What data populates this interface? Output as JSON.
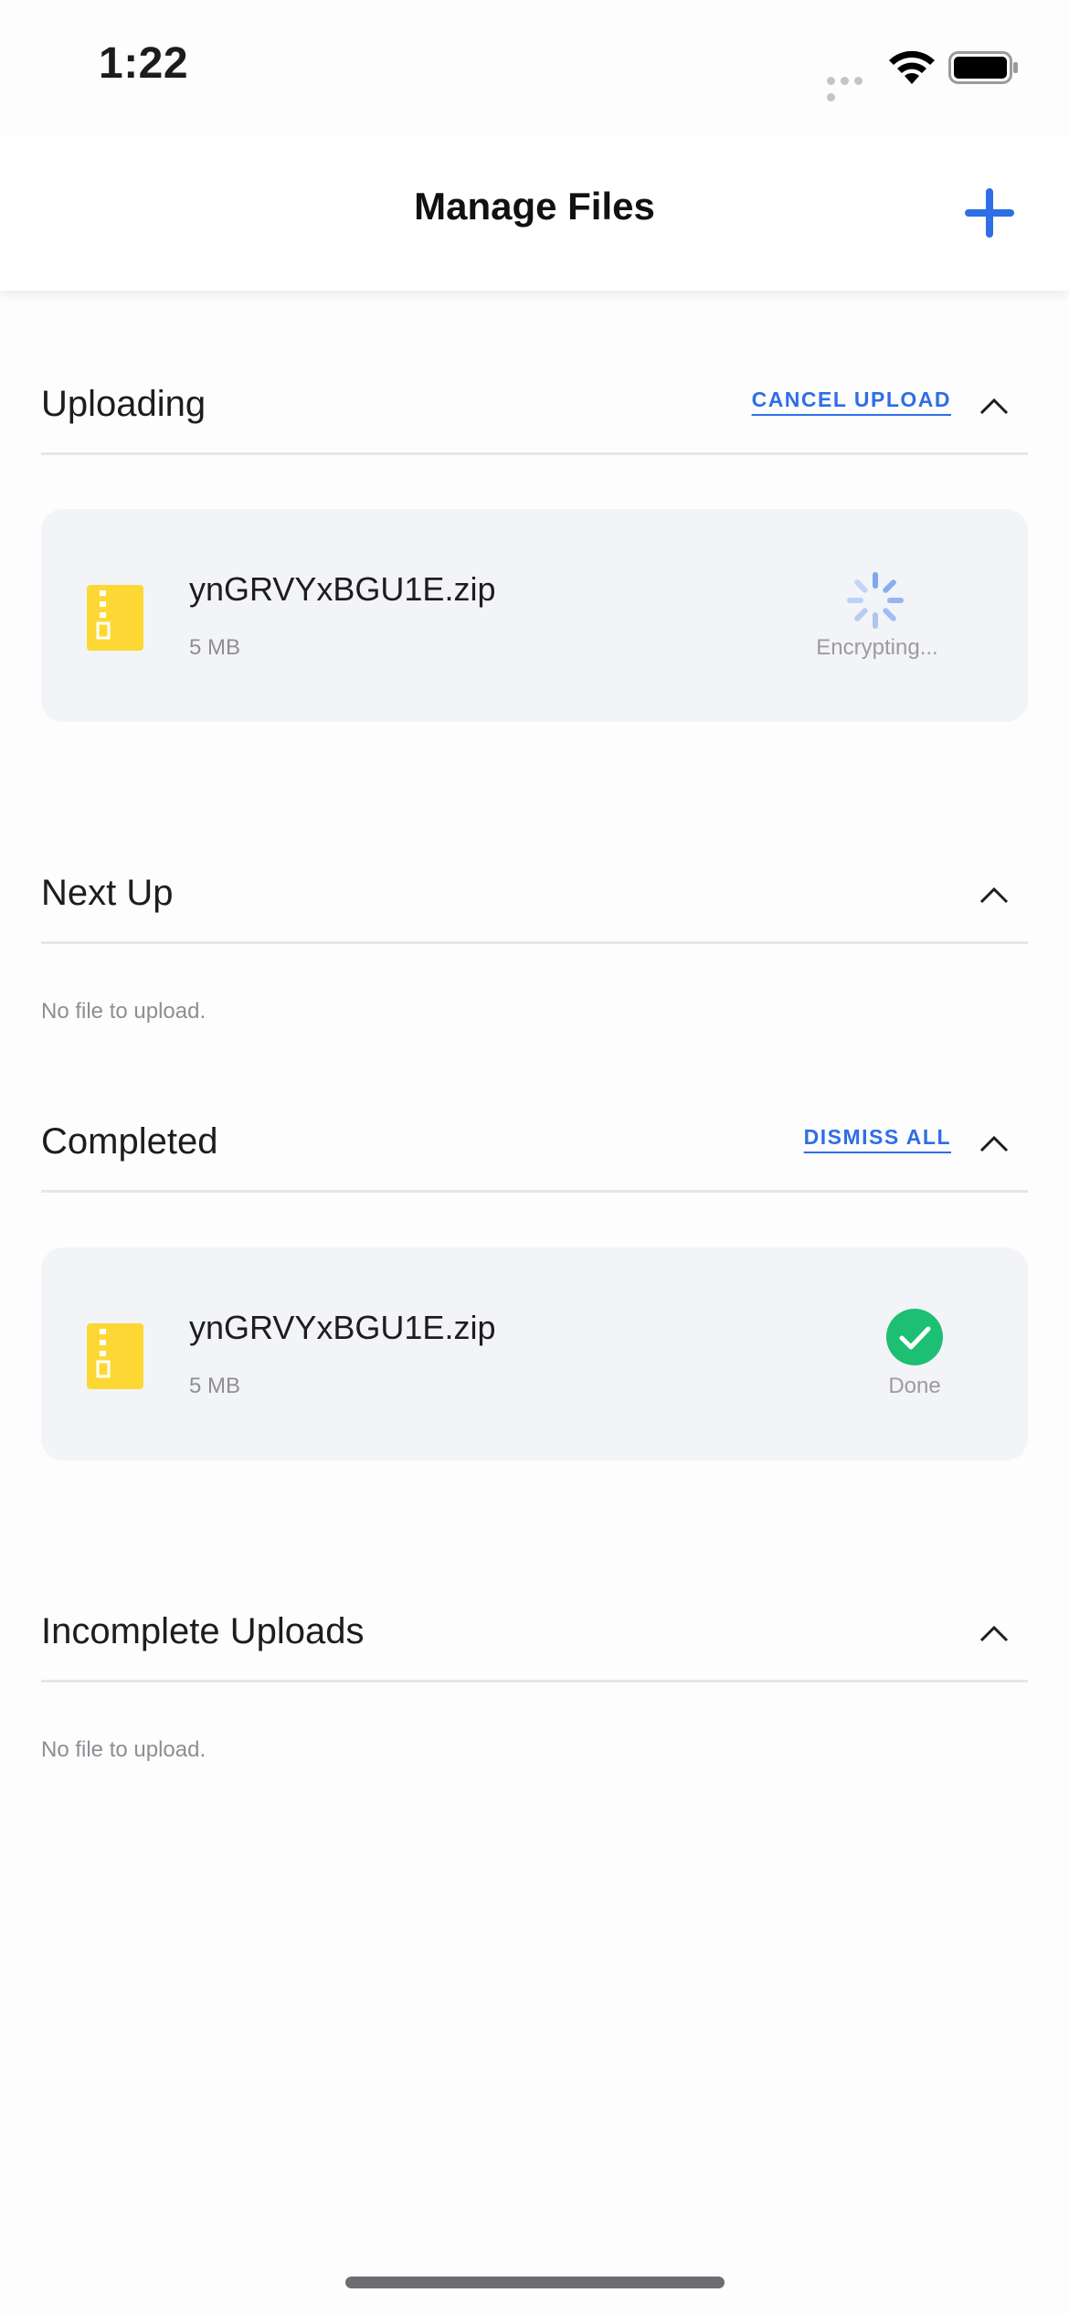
{
  "status_bar": {
    "time": "1:22"
  },
  "header": {
    "title": "Manage Files",
    "add_icon": "plus-icon"
  },
  "sections": {
    "uploading": {
      "title": "Uploading",
      "action": "CANCEL UPLOAD",
      "file": {
        "name": "ynGRVYxBGU1E.zip",
        "size": "5 MB",
        "status": "Encrypting..."
      }
    },
    "next_up": {
      "title": "Next Up",
      "empty": "No file to upload."
    },
    "completed": {
      "title": "Completed",
      "action": "DISMISS ALL",
      "file": {
        "name": "ynGRVYxBGU1E.zip",
        "size": "5 MB",
        "status": "Done"
      }
    },
    "incomplete": {
      "title": "Incomplete Uploads",
      "empty": "No file to upload."
    }
  },
  "colors": {
    "accent": "#2f6ee6",
    "success": "#1dbf73",
    "zip": "#fdd835",
    "card": "#f3f4f8"
  }
}
